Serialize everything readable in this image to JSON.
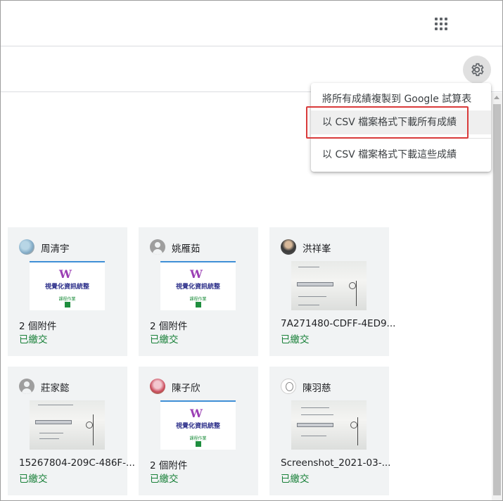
{
  "menu": {
    "items": [
      {
        "label": "將所有成績複製到 Google 試算表"
      },
      {
        "label": "以 CSV 檔案格式下載所有成績"
      },
      {
        "label": "以 CSV 檔案格式下載這些成績"
      }
    ],
    "highlighted_index": 1
  },
  "icons": {
    "apps": "apps-grid-icon",
    "settings": "gear-icon",
    "avatar_default": "default-avatar-icon"
  },
  "colors": {
    "status_turned_in": "#188038",
    "highlight_box": "#d93a3a",
    "card_background": "#f1f3f4",
    "slide_title": "#2c2f8a"
  },
  "cards": [
    {
      "name": "周清宇",
      "attachment": "2 個附件",
      "status": "已繳交",
      "thumb_type": "slide"
    },
    {
      "name": "姚雁茹",
      "attachment": "2 個附件",
      "status": "已繳交",
      "thumb_type": "slide"
    },
    {
      "name": "洪祥峯",
      "attachment": "7A271480-CDFF-4ED9...",
      "status": "已繳交",
      "thumb_type": "paper"
    },
    {
      "name": "莊家懿",
      "attachment": "15267804-209C-486F-...",
      "status": "已繳交",
      "thumb_type": "paper"
    },
    {
      "name": "陳子欣",
      "attachment": "2 個附件",
      "status": "已繳交",
      "thumb_type": "slide"
    },
    {
      "name": "陳羽慈",
      "attachment": "Screenshot_2021-03-...",
      "status": "已繳交",
      "thumb_type": "paper"
    }
  ],
  "slide": {
    "logo": "W",
    "title": "視覺化資訊統整",
    "subtitle": "課程作業",
    "badge": "Z"
  }
}
